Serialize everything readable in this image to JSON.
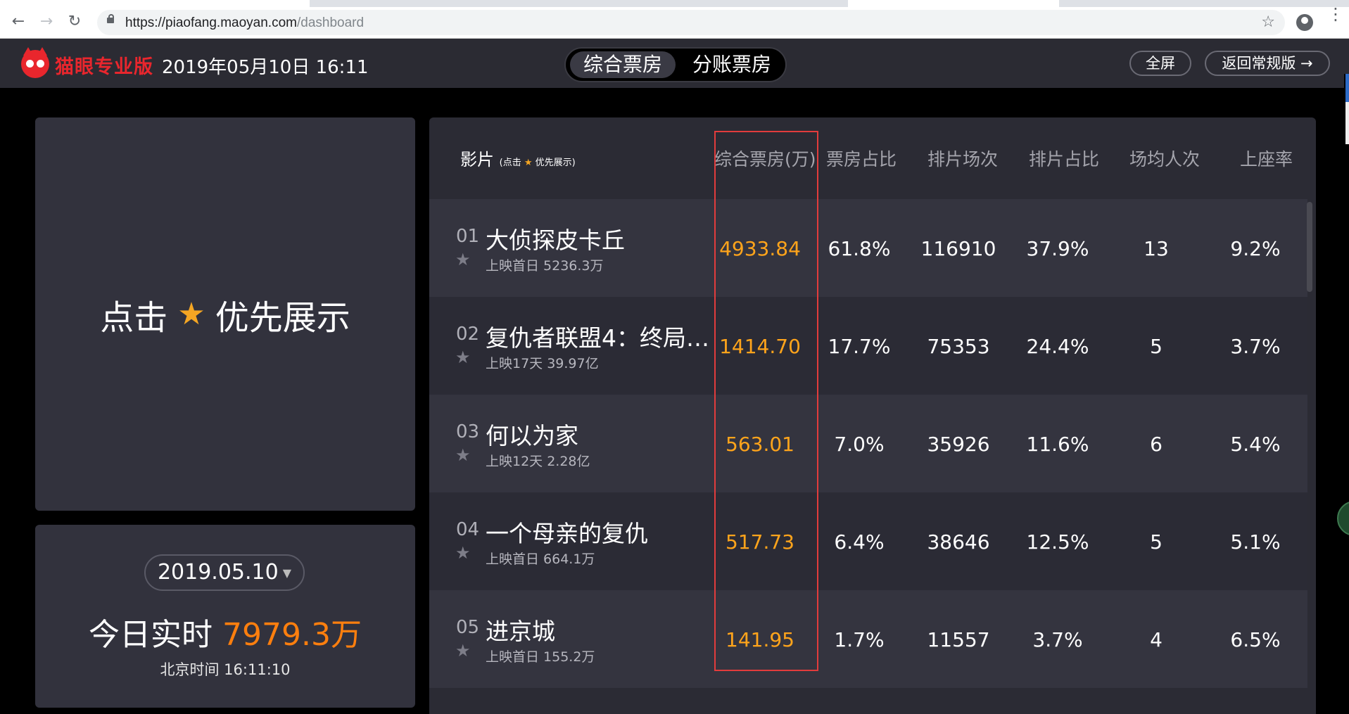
{
  "browser": {
    "url_base": "https://piaofang.maoyan.com",
    "url_path": "/dashboard"
  },
  "header": {
    "brand": "猫眼专业版",
    "datetime": "2019年05月10日 16:11",
    "tabs": [
      "综合票房",
      "分账票房"
    ],
    "active_tab": "综合票房",
    "fullscreen_label": "全屏",
    "back_label": "返回常规版 →"
  },
  "promo": {
    "text_before": "点击",
    "text_after": "优先展示"
  },
  "summary": {
    "date": "2019.05.10",
    "today_label": "今日实时",
    "today_amount": "7979.3万",
    "beijing_time": "北京时间 16:11:10"
  },
  "table": {
    "film_header": "影片",
    "film_header_hint_before": "(点击",
    "film_header_hint_after": "优先展示)",
    "columns": [
      "综合票房(万)",
      "票房占比",
      "排片场次",
      "排片占比",
      "场均人次",
      "上座率"
    ],
    "rows": [
      {
        "rank": "01",
        "name": "大侦探皮卡丘",
        "sub": "上映首日  5236.3万",
        "box_office": "4933.84",
        "bo_share": "61.8%",
        "shows": "116910",
        "show_share": "37.9%",
        "avg_people": "13",
        "occupancy": "9.2%"
      },
      {
        "rank": "02",
        "name": "复仇者联盟4：终局…",
        "sub": "上映17天  39.97亿",
        "box_office": "1414.70",
        "bo_share": "17.7%",
        "shows": "75353",
        "show_share": "24.4%",
        "avg_people": "5",
        "occupancy": "3.7%"
      },
      {
        "rank": "03",
        "name": "何以为家",
        "sub": "上映12天  2.28亿",
        "box_office": "563.01",
        "bo_share": "7.0%",
        "shows": "35926",
        "show_share": "11.6%",
        "avg_people": "6",
        "occupancy": "5.4%"
      },
      {
        "rank": "04",
        "name": "一个母亲的复仇",
        "sub": "上映首日  664.1万",
        "box_office": "517.73",
        "bo_share": "6.4%",
        "shows": "38646",
        "show_share": "12.5%",
        "avg_people": "5",
        "occupancy": "5.1%"
      },
      {
        "rank": "05",
        "name": "进京城",
        "sub": "上映首日  155.2万",
        "box_office": "141.95",
        "bo_share": "1.7%",
        "shows": "11557",
        "show_share": "3.7%",
        "avg_people": "4",
        "occupancy": "6.5%"
      }
    ]
  },
  "colors": {
    "accent_orange": "#ffa41b",
    "brand_red": "#e9262d",
    "highlight_box": "#e23c3c"
  }
}
